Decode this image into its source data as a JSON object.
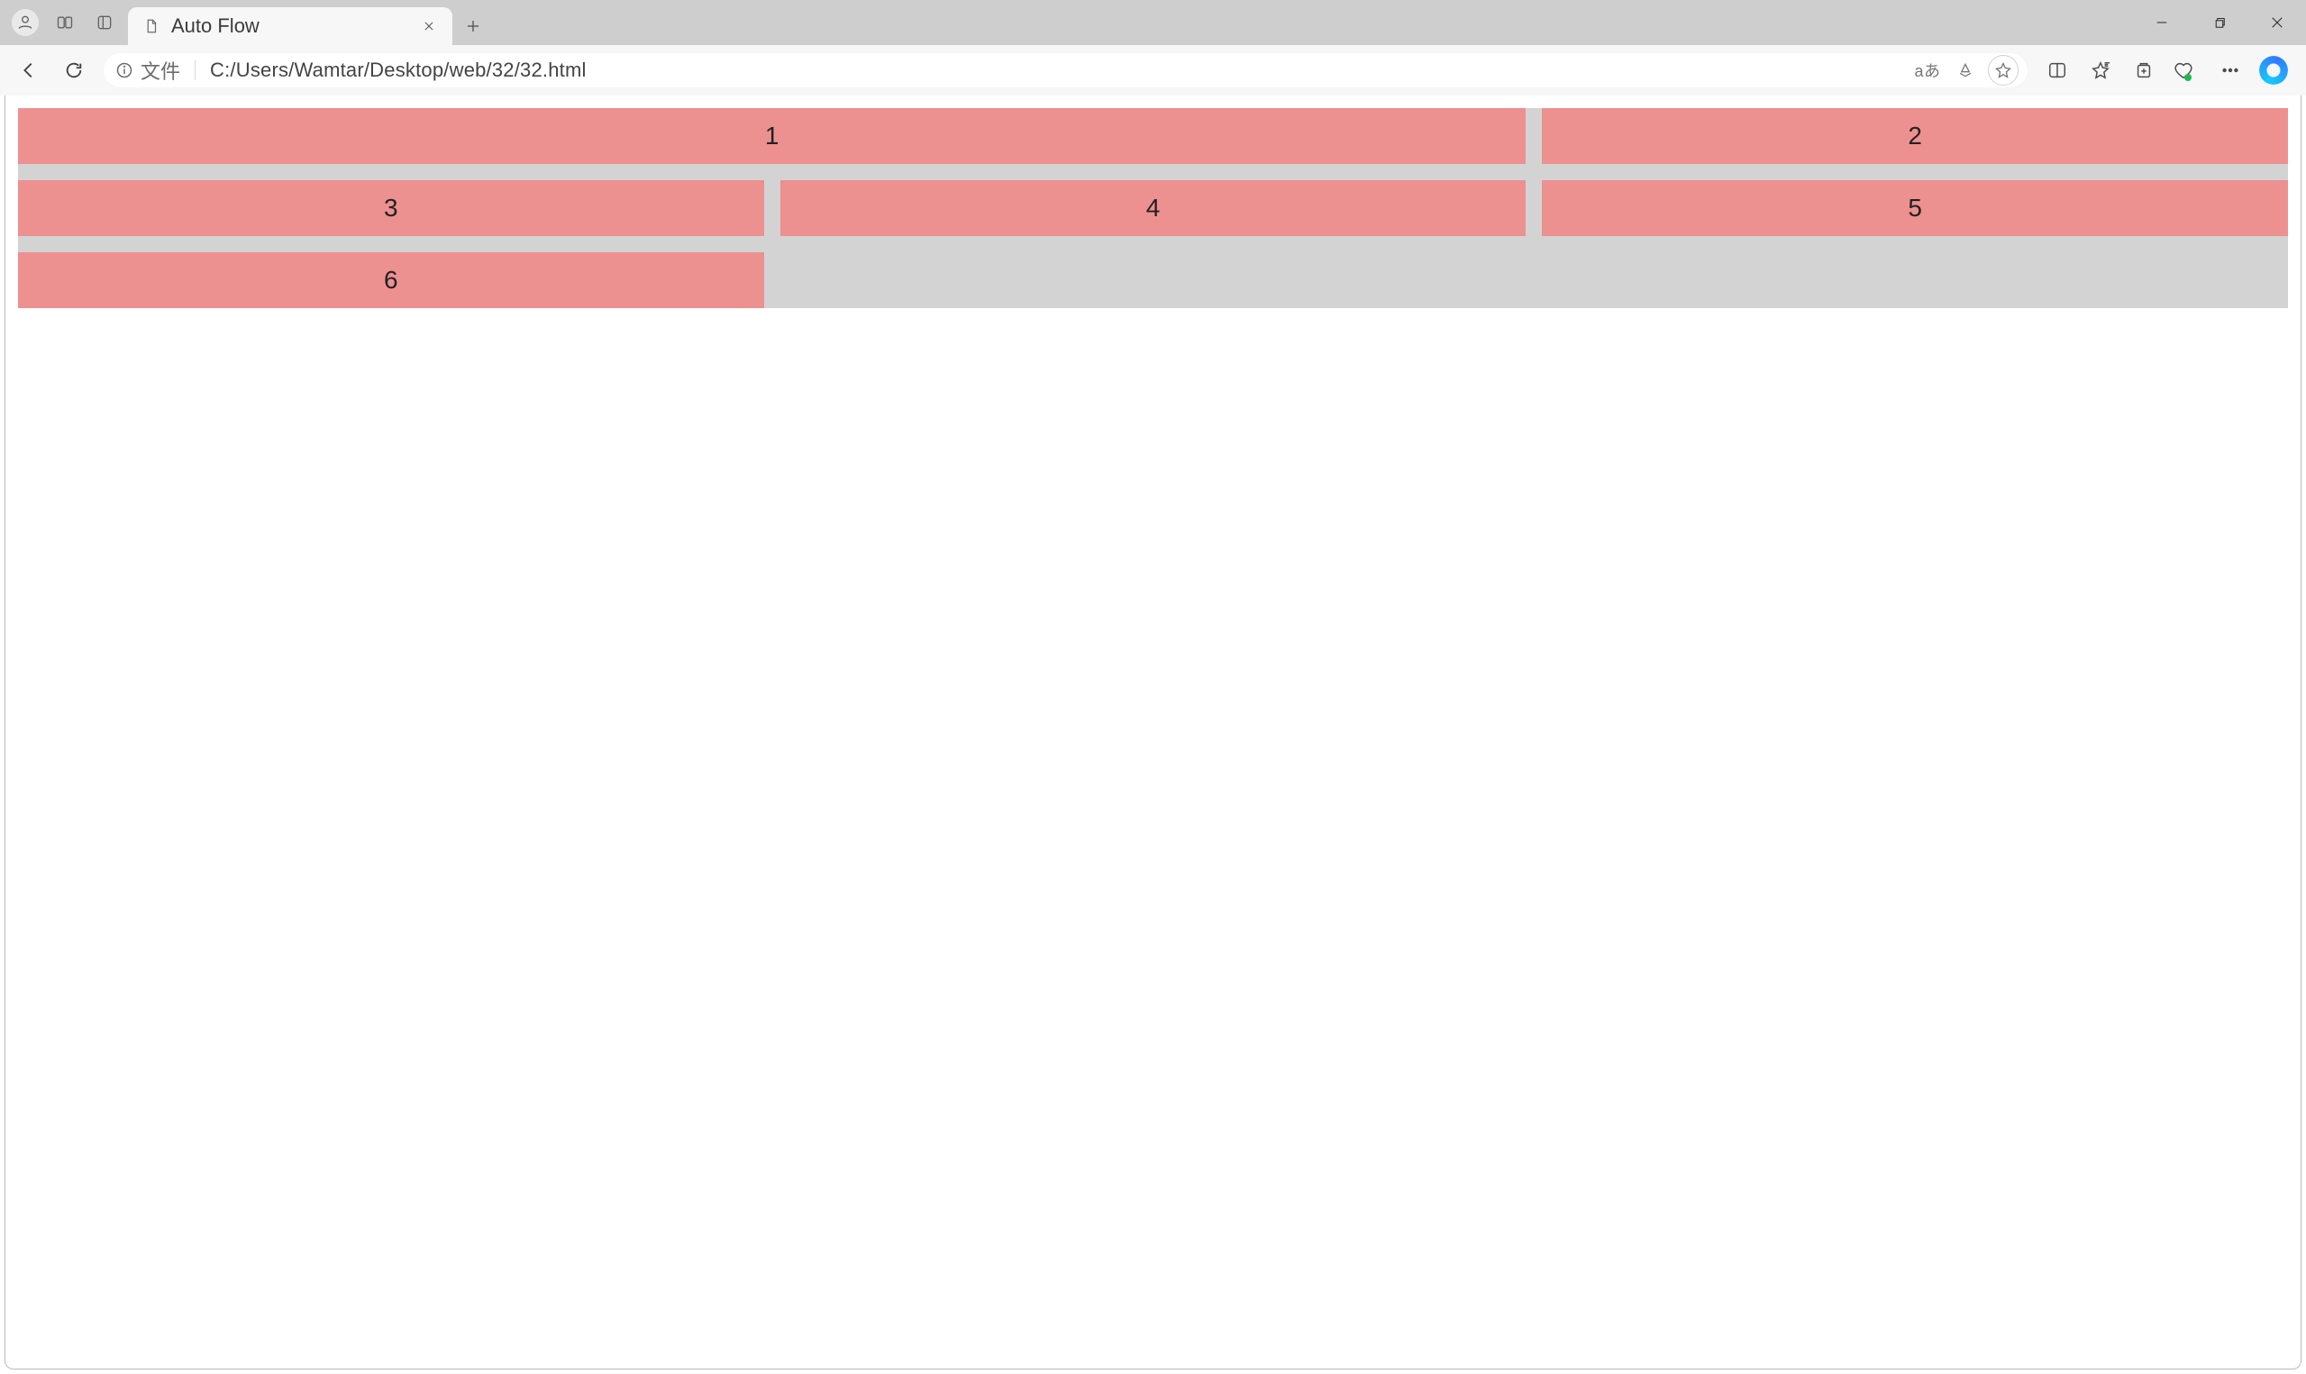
{
  "tab": {
    "title": "Auto Flow"
  },
  "addressbar": {
    "info_label": "文件",
    "url": "C:/Users/Wamtar/Desktop/web/32/32.html",
    "translate_label": "aあ"
  },
  "page": {
    "grid": {
      "cells": [
        "1",
        "2",
        "3",
        "4",
        "5",
        "6"
      ]
    }
  }
}
